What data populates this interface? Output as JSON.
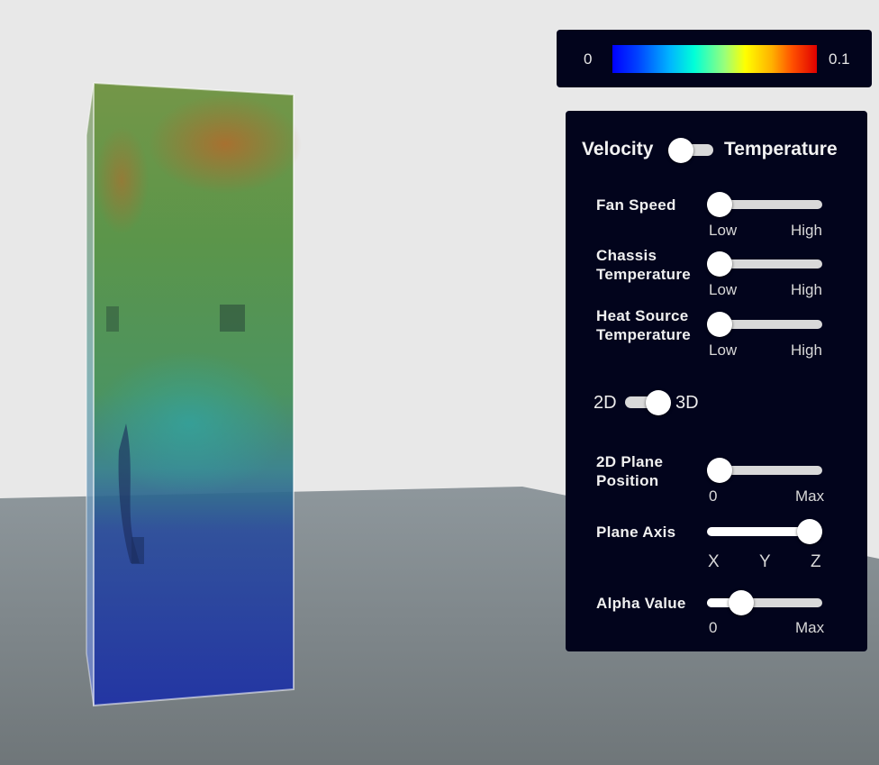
{
  "colorbar": {
    "min_label": "0",
    "max_label": "0.1",
    "colormap": "jet"
  },
  "panel": {
    "mode_toggle": {
      "left_label": "Velocity",
      "right_label": "Temperature",
      "state": "Velocity"
    },
    "fan_speed": {
      "label": "Fan Speed",
      "min_label": "Low",
      "max_label": "High",
      "value": 0.0
    },
    "chassis_temperature": {
      "label_line1": "Chassis",
      "label_line2": "Temperature",
      "min_label": "Low",
      "max_label": "High",
      "value": 0.0
    },
    "heat_source_temperature": {
      "label_line1": "Heat Source",
      "label_line2": "Temperature",
      "min_label": "Low",
      "max_label": "High",
      "value": 0.0
    },
    "dim_toggle": {
      "left_label": "2D",
      "right_label": "3D",
      "state": "3D"
    },
    "plane_position": {
      "label_line1": "2D Plane",
      "label_line2": "Position",
      "min_label": "0",
      "max_label": "Max",
      "value": 0.0
    },
    "plane_axis": {
      "label": "Plane Axis",
      "ticks": [
        "X",
        "Y",
        "Z"
      ],
      "value": "Z"
    },
    "alpha_value": {
      "label": "Alpha Value",
      "min_label": "0",
      "max_label": "Max",
      "value": 0.2
    }
  },
  "colors": {
    "panel_bg": "#02041c",
    "page_bg": "#e8e8e8",
    "floor": "#7d8589"
  }
}
